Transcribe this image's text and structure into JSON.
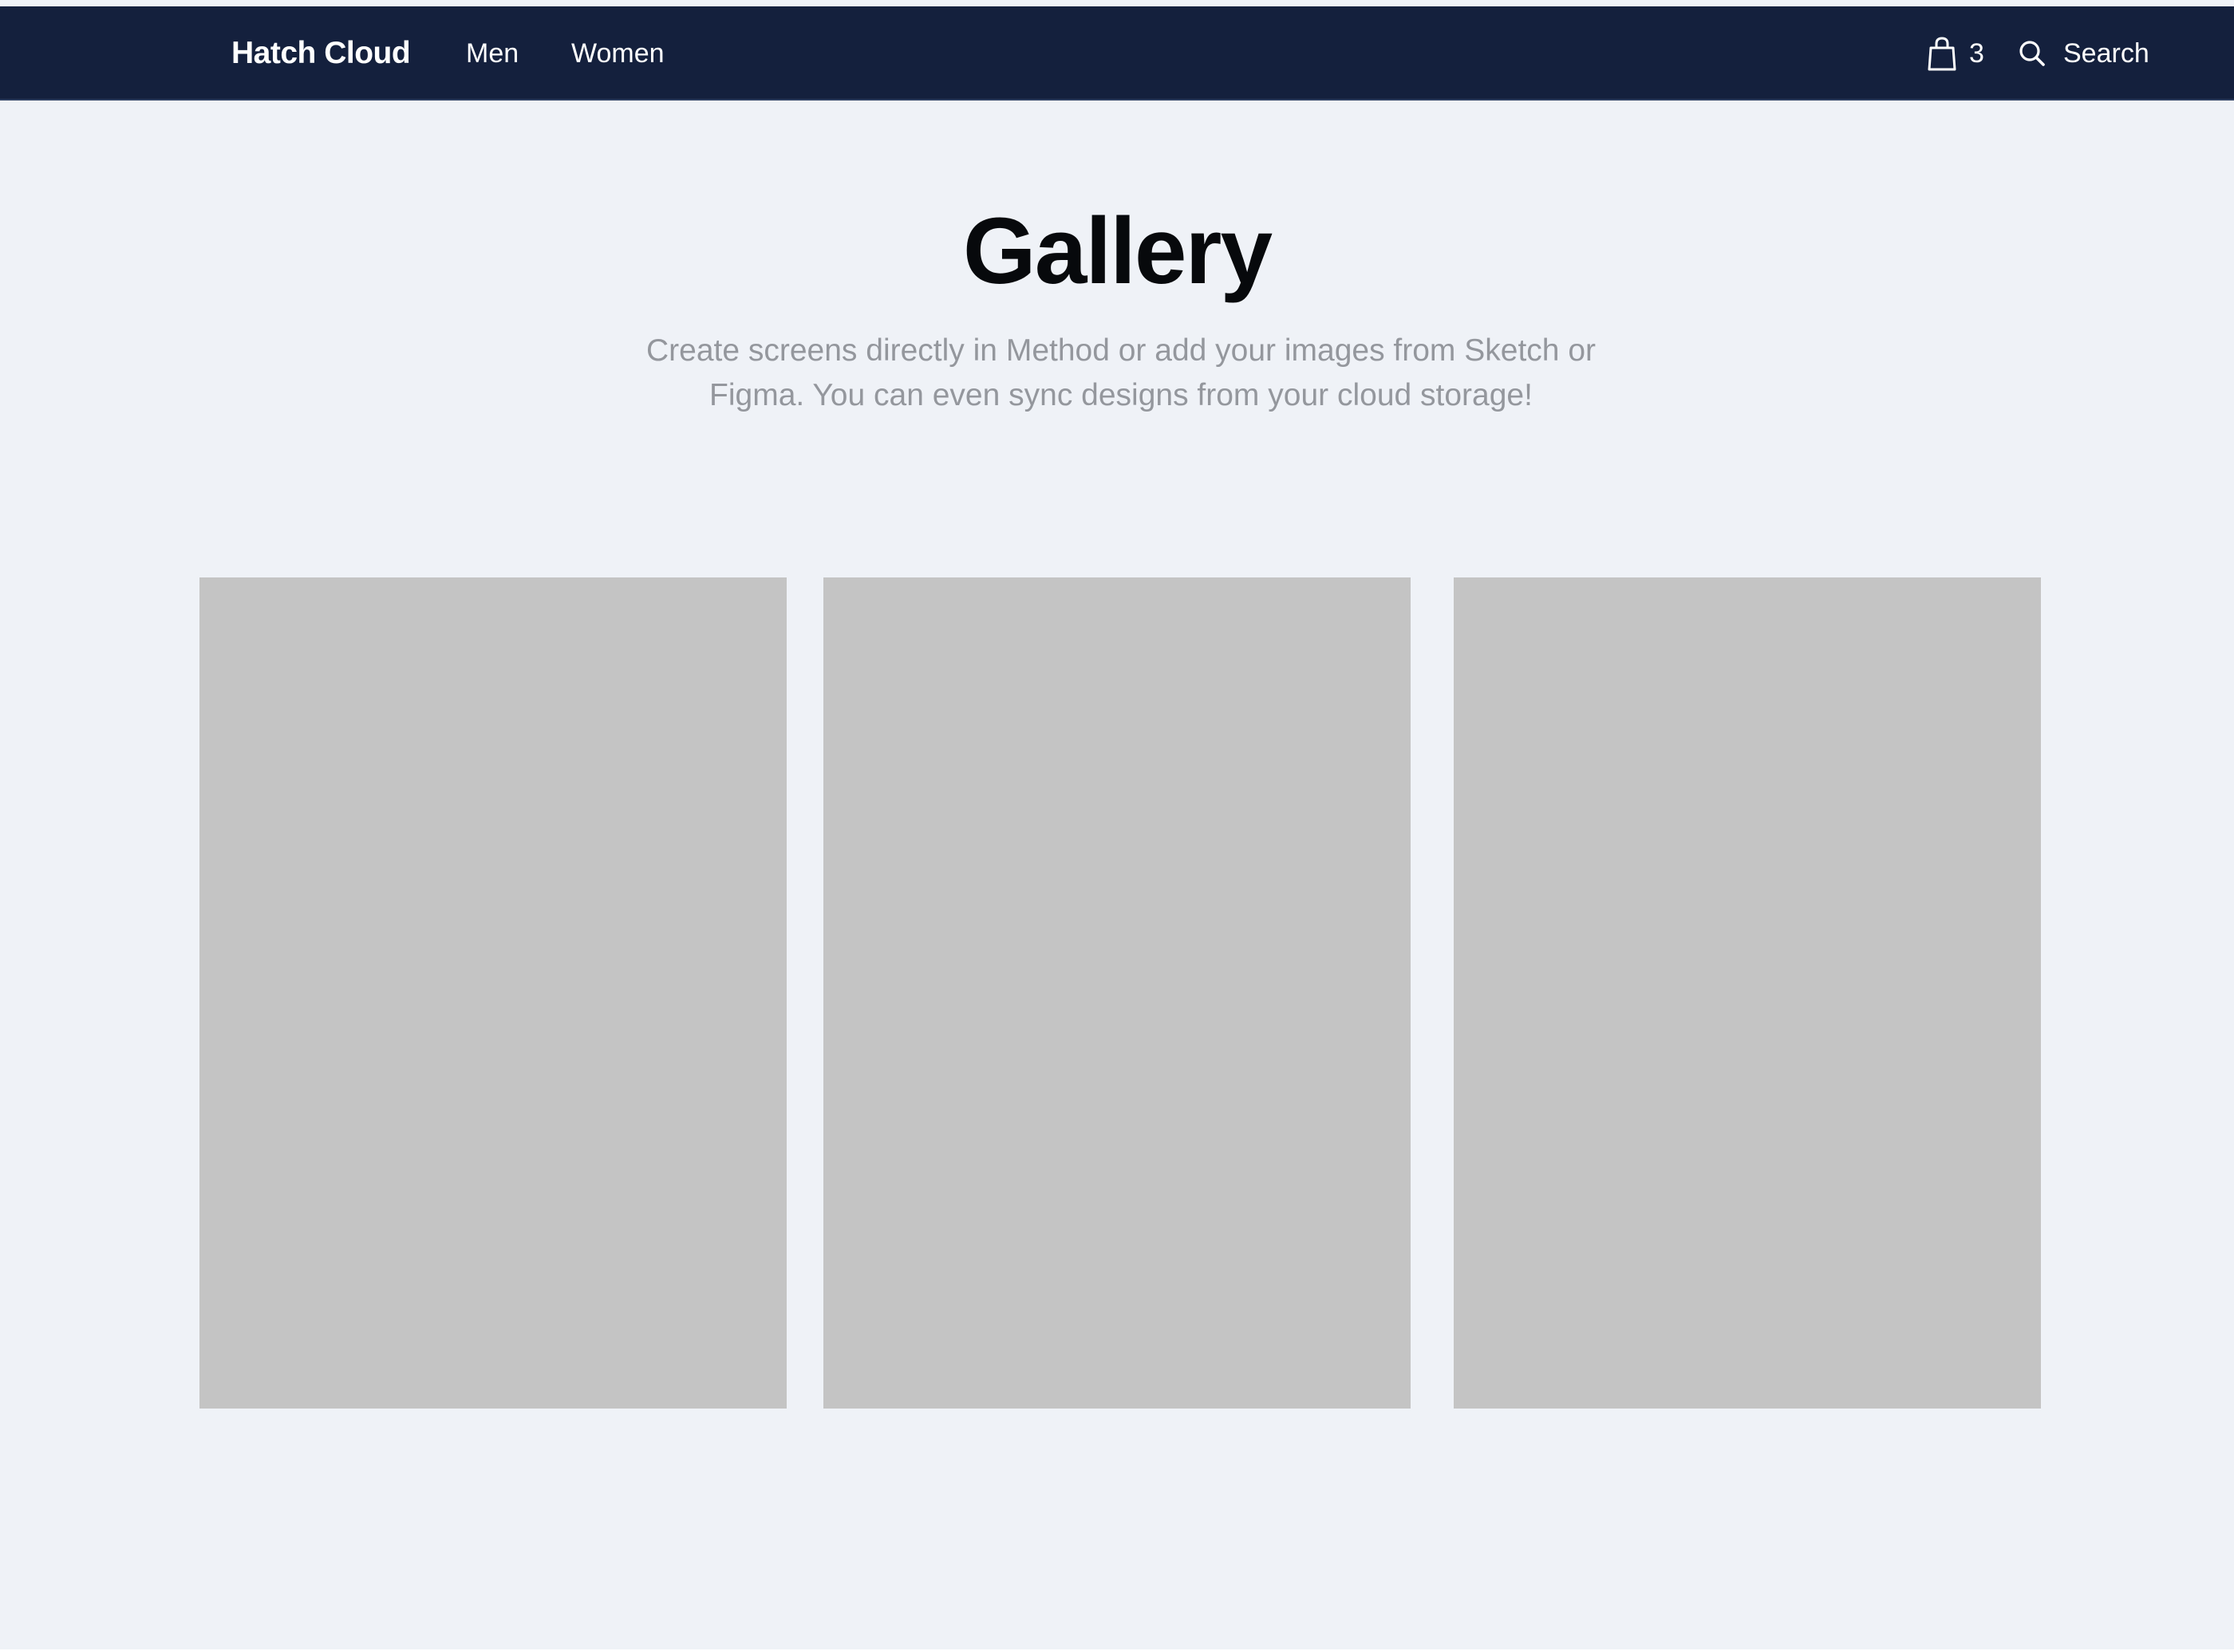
{
  "nav": {
    "brand": "Hatch Cloud",
    "links": [
      {
        "label": "Men"
      },
      {
        "label": "Women"
      }
    ],
    "cart": {
      "icon": "shopping-bag-icon",
      "count": "3"
    },
    "search": {
      "icon": "search-icon",
      "label": "Search"
    }
  },
  "hero": {
    "title": "Gallery",
    "subtitle": "Create screens directly in Method or add your images from Sketch or Figma. You can even sync designs from your cloud storage!"
  },
  "gallery": {
    "items": [
      {
        "placeholder_color": "#c4c4c4"
      },
      {
        "placeholder_color": "#c4c4c4"
      },
      {
        "placeholder_color": "#c4c4c4"
      }
    ]
  },
  "colors": {
    "navbar": "#14203d",
    "background": "#eff2f7",
    "title": "#07090c",
    "subtitle": "#94979d"
  }
}
